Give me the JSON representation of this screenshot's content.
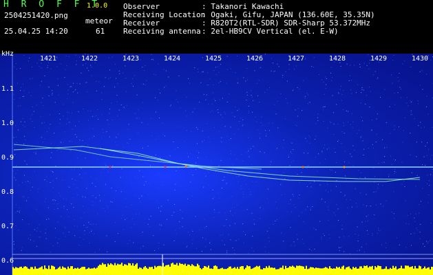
{
  "app": {
    "logo": "H R O F F T",
    "version": "1.0.0",
    "filename": "2504251420.png",
    "datetime": "25.04.25 14:20",
    "meteor_label": "meteor",
    "meteor_count": "61"
  },
  "info": {
    "observer_label": "Observer",
    "observer_value": ": Takanori Kawachi",
    "location_label": "Receiving Location",
    "location_value": ": Ogaki, Gifu, JAPAN (136.60E, 35.35N)",
    "receiver_label": "Receiver",
    "receiver_value": ": R820T2(RTL-SDR) SDR-Sharp 53.372MHz",
    "antenna_label": "Receiving antenna",
    "antenna_value": ": 2el-HB9CV Vertical (el. E-W)"
  },
  "axes": {
    "y_unit": "kHz",
    "y_ticks": [
      "1.1",
      "1.0",
      "0.9",
      "0.8",
      "0.7",
      "0.6"
    ],
    "x_ticks": [
      "1421",
      "1422",
      "1423",
      "1424",
      "1425",
      "1426",
      "1427",
      "1428",
      "1429",
      "1430"
    ]
  },
  "colors": {
    "background": "#000000",
    "spectrogram": "#0c22b5",
    "carrier": "#8fd8ff",
    "echo": "#9affc8",
    "amplitude": "#ffff00",
    "logo": "#55ff55"
  }
}
